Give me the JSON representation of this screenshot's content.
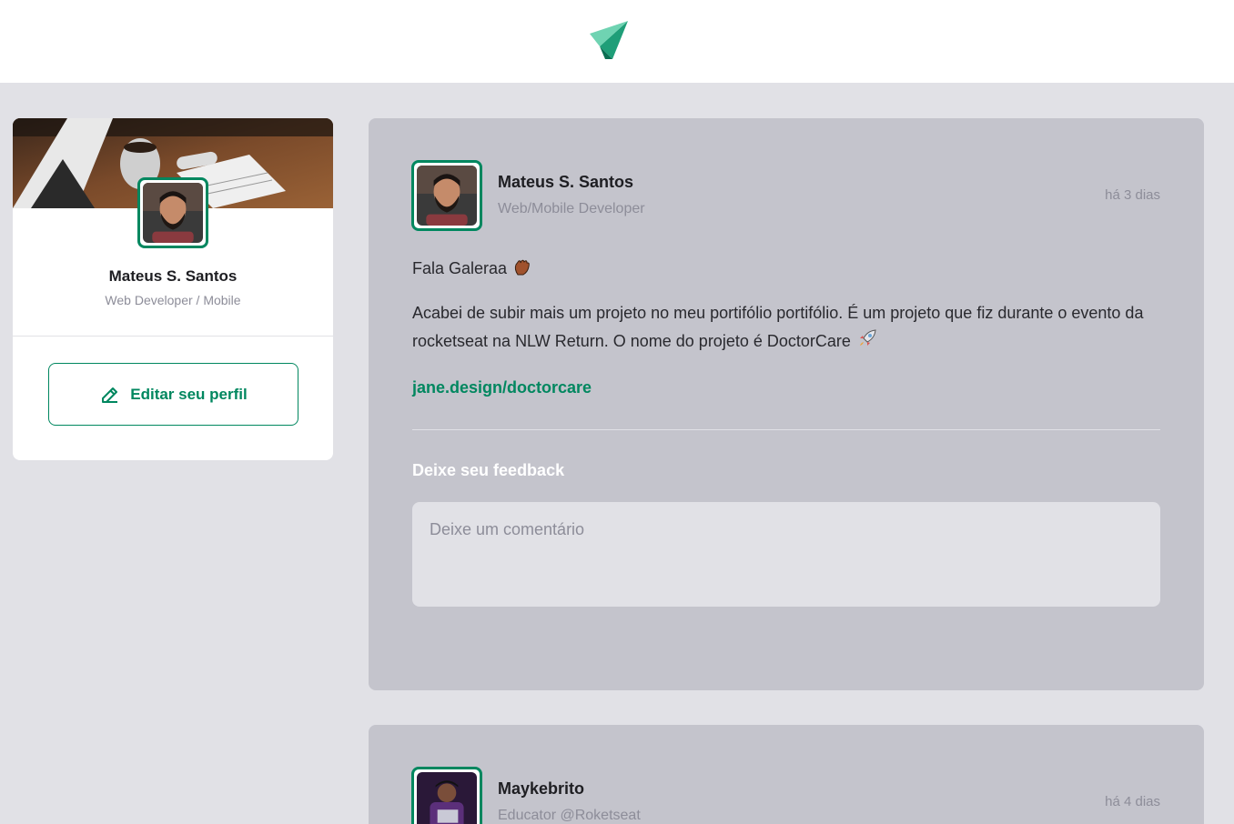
{
  "header": {
    "logo_icon": "ignite-feed-logo-icon"
  },
  "sidebar": {
    "name": "Mateus S. Santos",
    "role": "Web Developer / Mobile",
    "edit_button_label": "Editar seu perfil",
    "edit_icon": "pencil-icon"
  },
  "posts": [
    {
      "author": "Mateus S. Santos",
      "role": "Web/Mobile Developer",
      "time": "há 3 dias",
      "greeting": "Fala Galeraa",
      "greeting_emoji": "waving-hand-icon",
      "body": "Acabei de subir mais um projeto no meu portifólio portifólio. É um projeto que fiz durante o evento da rocketseat na NLW Return. O nome do projeto é DoctorCare",
      "body_emoji": "rocket-icon",
      "link": "jane.design/doctorcare",
      "feedback_label": "Deixe seu feedback",
      "comment_placeholder": "Deixe um comentário"
    },
    {
      "author": "Maykebrito",
      "role": "Educator @Roketseat",
      "time": "há 4 dias"
    }
  ],
  "colors": {
    "accent": "#00875f",
    "background": "#e1e1e6",
    "card": "#c4c4cc",
    "muted": "#8d8d99"
  }
}
